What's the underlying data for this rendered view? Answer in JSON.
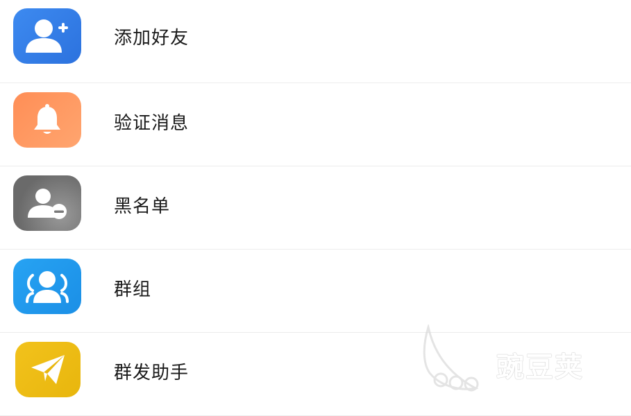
{
  "menu": {
    "items": [
      {
        "label": "添加好友",
        "icon": "add-user-icon",
        "color": "#2f7be6"
      },
      {
        "label": "验证消息",
        "icon": "bell-icon",
        "color": "#ff9a62"
      },
      {
        "label": "黑名单",
        "icon": "blocked-user-icon",
        "color": "#7a7a7a"
      },
      {
        "label": "群组",
        "icon": "group-icon",
        "color": "#1f98ea"
      },
      {
        "label": "群发助手",
        "icon": "paper-plane-icon",
        "color": "#efbe16"
      }
    ]
  },
  "watermark": {
    "text": "豌豆荚"
  }
}
